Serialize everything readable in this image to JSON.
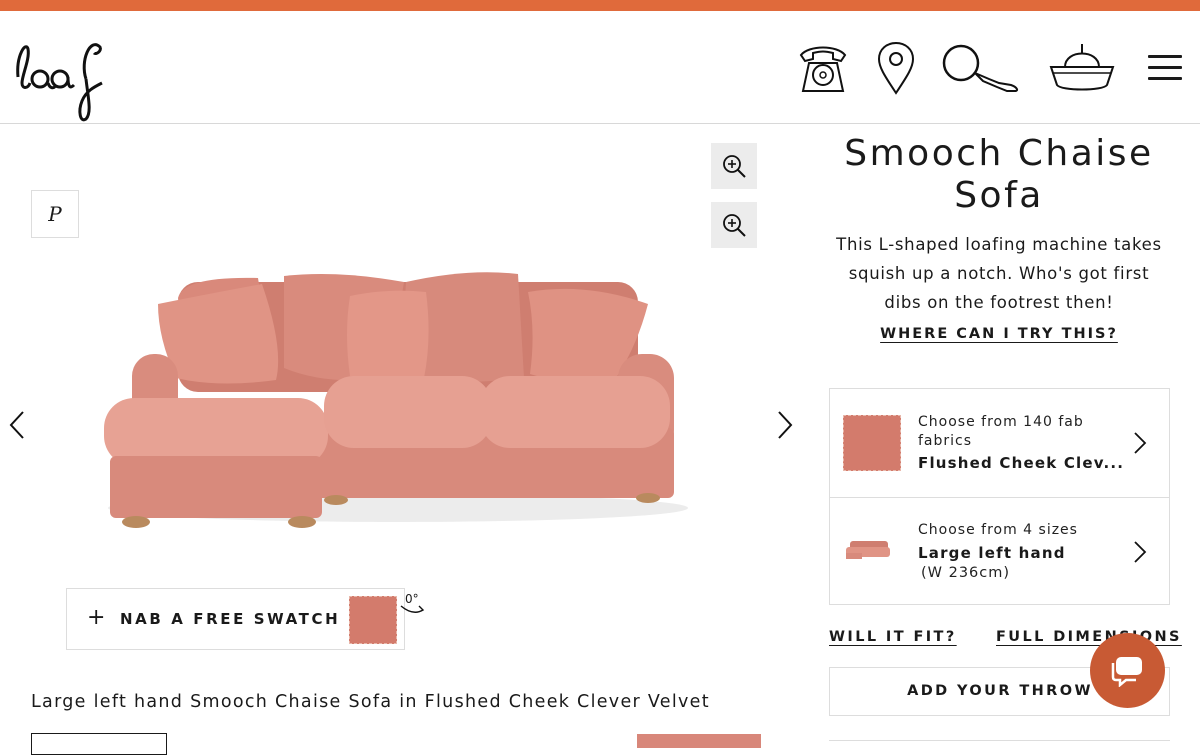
{
  "brand": {
    "logo_text": "loaf",
    "accent_color": "#e06a3b"
  },
  "header": {
    "icons": [
      "telephone-icon",
      "location-pin-icon",
      "magnifying-glass-icon",
      "basket-icon",
      "menu-icon"
    ]
  },
  "gallery": {
    "pinterest_label": "P",
    "swatch_button_label": "NAB A FREE SWATCH",
    "swatch_plus": "+",
    "rotation_label": "0°",
    "caption": "Large left hand Smooch Chaise Sofa in Flushed Cheek Clever Velvet"
  },
  "product": {
    "title": "Smooch Chaise Sofa",
    "description": "This L-shaped loafing machine takes squish up a notch. Who's got first dibs on the footrest then!",
    "try_link": "WHERE CAN I TRY THIS?",
    "fabric_option": {
      "prompt": "Choose from 140 fab fabrics",
      "value": "Flushed Cheek Clev...",
      "color": "#d37b6c"
    },
    "size_option": {
      "prompt": "Choose from 4 sizes",
      "value": "Large left hand",
      "detail": "(W 236cm)"
    },
    "will_it_fit": "WILL IT FIT?",
    "full_dimensions": "FULL DIMENSIONS",
    "add_throw": "ADD YOUR THROW"
  },
  "colors": {
    "sofa": "#dd8d7e",
    "chat_button": "#c85a34"
  }
}
